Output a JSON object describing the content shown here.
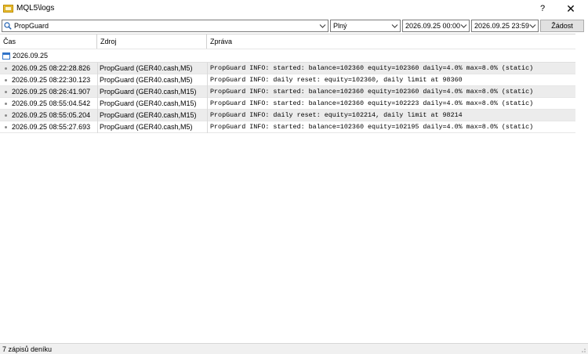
{
  "window": {
    "title": "MQL5\\logs",
    "help_label": "?",
    "close_label": "✕"
  },
  "toolbar": {
    "search_value": "PropGuard",
    "filter_value": "Plný",
    "date_from": "2026.09.25 00:00",
    "date_to": "2026.09.25 23:59",
    "request_label": "Žádost"
  },
  "table": {
    "columns": [
      "Čas",
      "Zdroj",
      "Zpráva"
    ],
    "group_label": "2026.09.25",
    "rows": [
      {
        "time": "2026.09.25 08:22:28.826",
        "source": "PropGuard (GER40.cash,M5)",
        "message": "PropGuard INFO: started: balance=102360 equity=102360 daily=4.0% max=8.0% (static)"
      },
      {
        "time": "2026.09.25 08:22:30.123",
        "source": "PropGuard (GER40.cash,M5)",
        "message": "PropGuard INFO: daily reset: equity=102360, daily limit at 98360"
      },
      {
        "time": "2026.09.25 08:26:41.907",
        "source": "PropGuard (GER40.cash,M15)",
        "message": "PropGuard INFO: started: balance=102360 equity=102360 daily=4.0% max=8.0% (static)"
      },
      {
        "time": "2026.09.25 08:55:04.542",
        "source": "PropGuard (GER40.cash,M15)",
        "message": "PropGuard INFO: started: balance=102360 equity=102223 daily=4.0% max=8.0% (static)"
      },
      {
        "time": "2026.09.25 08:55:05.204",
        "source": "PropGuard (GER40.cash,M15)",
        "message": "PropGuard INFO: daily reset: equity=102214, daily limit at 98214"
      },
      {
        "time": "2026.09.25 08:55:27.693",
        "source": "PropGuard (GER40.cash,M5)",
        "message": "PropGuard INFO: started: balance=102360 equity=102195 daily=4.0% max=8.0% (static)"
      }
    ]
  },
  "status": {
    "text": "7 zápisů deníku"
  },
  "colors": {
    "folder_icon": "#e8b400",
    "calendar_icon": "#2f73c9",
    "alt_row": "#ececec"
  },
  "icons": [
    "folder-icon",
    "search-icon",
    "chevron-down-icon",
    "calendar-icon",
    "bullet-icon",
    "resize-grip-icon"
  ]
}
